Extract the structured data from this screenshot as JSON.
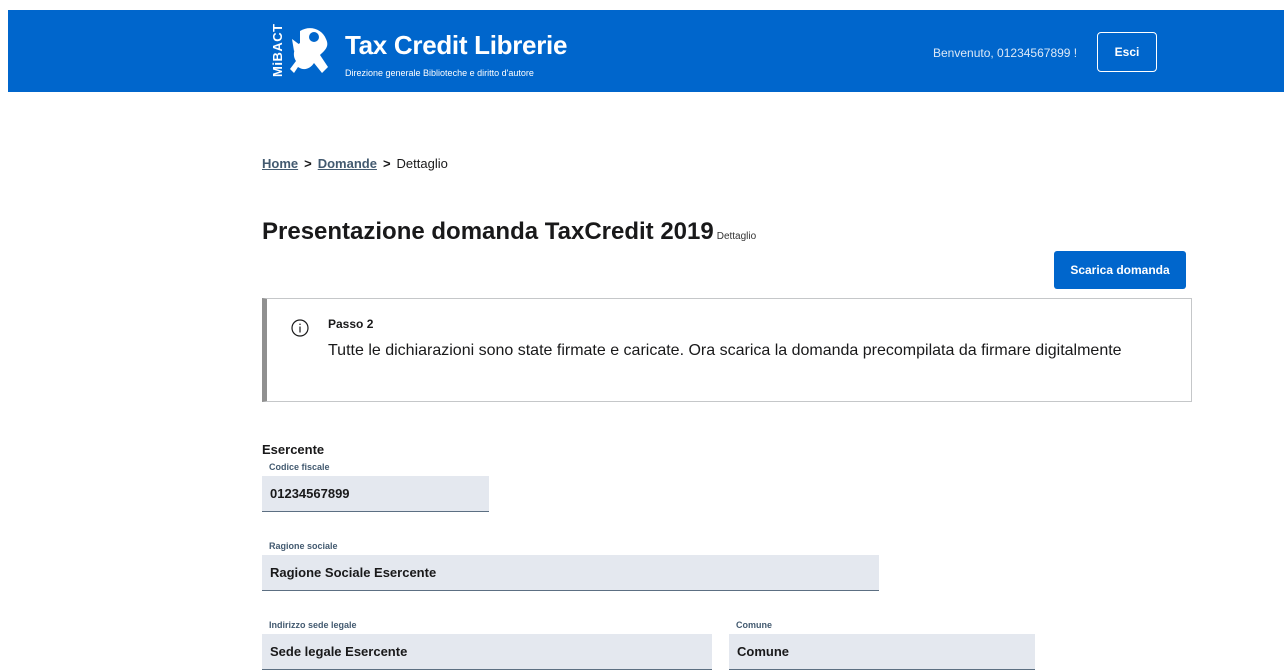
{
  "header": {
    "logo_text": "MiBACT",
    "title": "Tax Credit Librerie",
    "subtitle": "Direzione generale Biblioteche e diritto d'autore",
    "welcome": "Benvenuto, 01234567899 !",
    "logout_label": "Esci"
  },
  "breadcrumb": {
    "items": [
      "Home",
      "Domande",
      "Dettaglio"
    ],
    "separator": ">"
  },
  "page": {
    "title": "Presentazione domanda TaxCredit 2019",
    "subtitle": "Dettaglio",
    "download_label": "Scarica domanda"
  },
  "alert": {
    "icon": "info-icon",
    "title": "Passo 2",
    "text": "Tutte le dichiarazioni sono state firmate e caricate. Ora scarica la domanda precompilata da firmare digitalmente"
  },
  "form": {
    "section_title": "Esercente",
    "codice_fiscale": {
      "label": "Codice fiscale",
      "value": "01234567899"
    },
    "ragione_sociale": {
      "label": "Ragione sociale",
      "value": "Ragione Sociale Esercente"
    },
    "indirizzo": {
      "label": "Indirizzo sede legale",
      "value": "Sede legale Esercente"
    },
    "comune": {
      "label": "Comune",
      "value": "Comune"
    }
  },
  "colors": {
    "primary": "#0066cc",
    "field_bg": "#e4e8ef",
    "label": "#435a70"
  }
}
